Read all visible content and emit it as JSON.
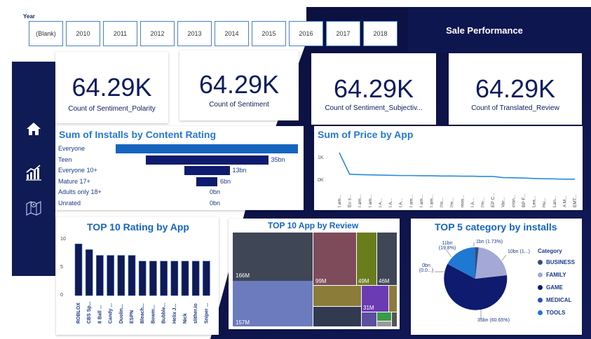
{
  "year_slicer": {
    "title": "Year",
    "options": [
      "(Blank)",
      "2010",
      "2011",
      "2012",
      "2013",
      "2014",
      "2015",
      "2016",
      "2017",
      "2018"
    ]
  },
  "header": {
    "title": "Sale Performance"
  },
  "nav": {
    "icons": [
      "home-icon",
      "bar-chart-icon",
      "map-icon"
    ]
  },
  "kpis": [
    {
      "value": "64.29K",
      "label": "Count of Sentiment_Polarity"
    },
    {
      "value": "64.29K",
      "label": "Count of Sentiment"
    },
    {
      "value": "64.29K",
      "label": "Count of Sentiment_Subjectiv..."
    },
    {
      "value": "64.29K",
      "label": "Count of Translated_Review"
    }
  ],
  "installs_by_rating": {
    "title": "Sum of Installs by Content Rating",
    "rows": [
      {
        "label": "Everyone",
        "value_label": "",
        "value": 52
      },
      {
        "label": "Teen",
        "value_label": "35bn",
        "value": 35
      },
      {
        "label": "Everyone 10+",
        "value_label": "13bn",
        "value": 13
      },
      {
        "label": "Mature 17+",
        "value_label": "6bn",
        "value": 6
      },
      {
        "label": "Adults only 18+",
        "value_label": "0bn",
        "value": 0
      },
      {
        "label": "Unrated",
        "value_label": "0bn",
        "value": 0
      }
    ],
    "color": "#1565c0",
    "color_dark": "#0e1b6e"
  },
  "price_by_app": {
    "title": "Sum of Price by App",
    "y_ticks": [
      "1K",
      "0K"
    ],
    "x_labels": [
      "I am...",
      "Eu s...",
      "I am...",
      "I am...",
      "I A...",
      "I A...",
      "I A...",
      "I am...",
      "I am...",
      "I am...",
      "I'm...",
      "I'm...",
      "mos...",
      "I A...",
      "I'm...",
      "EP C...",
      "Var...",
      "cron...",
      "BP F...",
      "Lea...",
      "Hu...",
      "Lan...",
      "A M...",
      "EMT..."
    ],
    "chart_data": {
      "type": "line",
      "y_max": 1.3,
      "values": [
        1.3,
        0.35,
        0.33,
        0.32,
        0.31,
        0.3,
        0.29,
        0.29,
        0.28,
        0.28,
        0.27,
        0.27,
        0.26,
        0.26,
        0.25,
        0.25,
        0.2,
        0.19,
        0.18,
        0.16,
        0.15,
        0.14,
        0.13,
        0.13
      ]
    },
    "color": "#2b8be0"
  },
  "top10_rating": {
    "title": "TOP 10 Rating by App",
    "chart_data": {
      "type": "bar",
      "categories": [
        "ROBLOX",
        "CBS Sp...",
        "8 Ball ...",
        "Candy ...",
        "Duolin...",
        "ESPN",
        "Bleach...",
        "Bowm...",
        "Bubble...",
        "Helix J...",
        "Nick",
        "slither.io",
        "Sniper ..."
      ],
      "values": [
        9,
        8,
        7,
        7,
        7,
        7,
        6,
        6,
        6,
        6,
        6,
        6,
        6
      ],
      "y_ticks": [
        "10",
        "5",
        "0"
      ],
      "ylim": [
        0,
        10
      ]
    },
    "color": "#0e1b55"
  },
  "top10_review": {
    "title": "TOP 10 App by Review",
    "chart_data": {
      "type": "treemap",
      "labels": [
        "166M",
        "157M",
        "99M",
        "49M",
        "46M",
        "31M"
      ]
    }
  },
  "top5_category": {
    "title": "TOP 5 category by installs",
    "legend_title": "Category",
    "chart_data": {
      "type": "pie",
      "slices": [
        {
          "name": "BUSINESS",
          "color": "#3c4b7a",
          "label": "1bn (1.73%)"
        },
        {
          "name": "FAMILY",
          "color": "#a3a8d6",
          "label": "10bn (1...)"
        },
        {
          "name": "GAME",
          "color": "#0e1b6e",
          "label": "35bn (60.65%)"
        },
        {
          "name": "MEDICAL",
          "color": "#2a50c0",
          "label": "0bn (0.0...)"
        },
        {
          "name": "TOOLS",
          "color": "#1f78d1",
          "label": "11bn (19.8%)"
        }
      ]
    }
  }
}
